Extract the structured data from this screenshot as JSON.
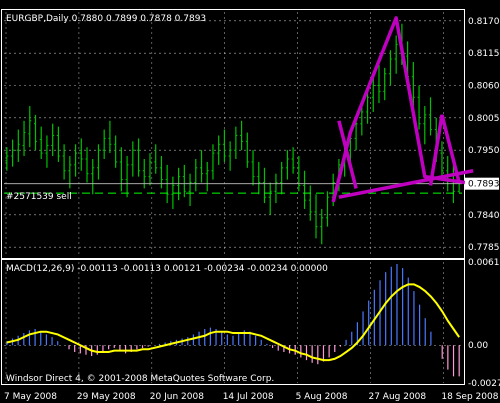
{
  "header": {
    "symbol_line": "EURGBP,Daily  0.7880 0.7899 0.7878 0.7893",
    "order_label": "#2571539 sell"
  },
  "footer": {
    "copyright": "Windsor Direct 4, © 2001-2008 MetaQuotes Software Corp."
  },
  "macd": {
    "title": "MACD(12,26,9) -0.00113 -0.00113 0.00121 -0.00234 -0.00234 0.00000"
  },
  "price_axis": {
    "labels": [
      "0.8170",
      "0.8115",
      "0.8060",
      "0.8005",
      "0.7950",
      "0.7893",
      "0.7840",
      "0.7785"
    ],
    "current": "0.7893"
  },
  "macd_axis": {
    "labels": [
      "0.00615",
      "0.00",
      "-0.00279"
    ]
  },
  "time_axis": {
    "labels": [
      "7 May 2008",
      "29 May 2008",
      "20 Jun 2008",
      "14 Jul 2008",
      "5 Aug 2008",
      "27 Aug 2008",
      "18 Sep 2008"
    ]
  },
  "colors": {
    "background": "#000000",
    "candles": "#00c000",
    "grid": "#ffffff",
    "pattern": "#c000c0",
    "signal": "#ffff00",
    "hist_pos": "#4a78ff",
    "hist_neg": "#ff9ad8",
    "order_line": "#00ff00",
    "current_line": "#c0c0c0"
  },
  "chart_data": [
    {
      "type": "candlestick",
      "title": "EURGBP,Daily",
      "ylim": [
        0.777,
        0.8185
      ],
      "x_labels": [
        "7 May 2008",
        "29 May 2008",
        "20 Jun 2008",
        "14 Jul 2008",
        "5 Aug 2008",
        "27 Aug 2008",
        "18 Sep 2008"
      ],
      "ohlc": [
        [
          0.7932,
          0.7955,
          0.7915,
          0.794
        ],
        [
          0.794,
          0.7968,
          0.7922,
          0.795
        ],
        [
          0.795,
          0.7985,
          0.793,
          0.796
        ],
        [
          0.7958,
          0.8,
          0.794,
          0.798
        ],
        [
          0.7978,
          0.8025,
          0.7955,
          0.8
        ],
        [
          0.7995,
          0.801,
          0.795,
          0.7965
        ],
        [
          0.7968,
          0.799,
          0.7935,
          0.7945
        ],
        [
          0.7945,
          0.7975,
          0.792,
          0.7958
        ],
        [
          0.7958,
          0.7995,
          0.794,
          0.7975
        ],
        [
          0.7975,
          0.799,
          0.793,
          0.794
        ],
        [
          0.794,
          0.796,
          0.79,
          0.7915
        ],
        [
          0.7915,
          0.794,
          0.7885,
          0.7925
        ],
        [
          0.7925,
          0.796,
          0.7905,
          0.7945
        ],
        [
          0.7945,
          0.797,
          0.7915,
          0.7935
        ],
        [
          0.7935,
          0.7955,
          0.7895,
          0.791
        ],
        [
          0.791,
          0.7935,
          0.7875,
          0.792
        ],
        [
          0.792,
          0.796,
          0.79,
          0.795
        ],
        [
          0.795,
          0.7985,
          0.7935,
          0.797
        ],
        [
          0.797,
          0.8,
          0.7945,
          0.796
        ],
        [
          0.796,
          0.7975,
          0.792,
          0.793
        ],
        [
          0.793,
          0.7955,
          0.788,
          0.79
        ],
        [
          0.79,
          0.794,
          0.787,
          0.7925
        ],
        [
          0.7925,
          0.7965,
          0.7905,
          0.795
        ],
        [
          0.795,
          0.797,
          0.7905,
          0.7915
        ],
        [
          0.7915,
          0.7935,
          0.7885,
          0.7905
        ],
        [
          0.7905,
          0.7945,
          0.789,
          0.793
        ],
        [
          0.793,
          0.796,
          0.791,
          0.792
        ],
        [
          0.792,
          0.794,
          0.7885,
          0.79
        ],
        [
          0.79,
          0.7925,
          0.786,
          0.7875
        ],
        [
          0.7875,
          0.7905,
          0.785,
          0.789
        ],
        [
          0.789,
          0.792,
          0.7865,
          0.7905
        ],
        [
          0.7905,
          0.7925,
          0.787,
          0.788
        ],
        [
          0.788,
          0.791,
          0.7855,
          0.7895
        ],
        [
          0.7895,
          0.7935,
          0.788,
          0.792
        ],
        [
          0.792,
          0.795,
          0.7895,
          0.791
        ],
        [
          0.791,
          0.793,
          0.788,
          0.7915
        ],
        [
          0.7915,
          0.796,
          0.79,
          0.7945
        ],
        [
          0.7945,
          0.7975,
          0.7925,
          0.796
        ],
        [
          0.796,
          0.7985,
          0.793,
          0.794
        ],
        [
          0.794,
          0.7965,
          0.7915,
          0.795
        ],
        [
          0.795,
          0.799,
          0.7935,
          0.7975
        ],
        [
          0.7975,
          0.8,
          0.795,
          0.7965
        ],
        [
          0.7965,
          0.798,
          0.792,
          0.793
        ],
        [
          0.793,
          0.795,
          0.789,
          0.7905
        ],
        [
          0.7905,
          0.793,
          0.7875,
          0.7895
        ],
        [
          0.7895,
          0.792,
          0.786,
          0.787
        ],
        [
          0.787,
          0.7895,
          0.784,
          0.788
        ],
        [
          0.788,
          0.791,
          0.786,
          0.7895
        ],
        [
          0.7895,
          0.793,
          0.7875,
          0.792
        ],
        [
          0.792,
          0.795,
          0.79,
          0.7935
        ],
        [
          0.7935,
          0.7955,
          0.791,
          0.792
        ],
        [
          0.792,
          0.794,
          0.788,
          0.789
        ],
        [
          0.789,
          0.7915,
          0.785,
          0.7865
        ],
        [
          0.7865,
          0.789,
          0.783,
          0.7845
        ],
        [
          0.7845,
          0.7875,
          0.78,
          0.782
        ],
        [
          0.782,
          0.785,
          0.779,
          0.7835
        ],
        [
          0.7835,
          0.788,
          0.782,
          0.787
        ],
        [
          0.787,
          0.791,
          0.7855,
          0.7895
        ],
        [
          0.7895,
          0.7935,
          0.788,
          0.7925
        ],
        [
          0.7925,
          0.7965,
          0.7905,
          0.795
        ],
        [
          0.795,
          0.7985,
          0.793,
          0.797
        ],
        [
          0.797,
          0.801,
          0.795,
          0.7995
        ],
        [
          0.7995,
          0.803,
          0.7975,
          0.8015
        ],
        [
          0.8015,
          0.8055,
          0.7995,
          0.804
        ],
        [
          0.804,
          0.8075,
          0.8015,
          0.806
        ],
        [
          0.806,
          0.8095,
          0.803,
          0.805
        ],
        [
          0.805,
          0.809,
          0.8035,
          0.808
        ],
        [
          0.808,
          0.812,
          0.806,
          0.8105
        ],
        [
          0.8105,
          0.8145,
          0.808,
          0.813
        ],
        [
          0.813,
          0.8165,
          0.8095,
          0.811
        ],
        [
          0.811,
          0.8135,
          0.806,
          0.8075
        ],
        [
          0.8075,
          0.81,
          0.8025,
          0.804
        ],
        [
          0.804,
          0.806,
          0.7985,
          0.7995
        ],
        [
          0.7995,
          0.8025,
          0.796,
          0.801
        ],
        [
          0.801,
          0.804,
          0.7975,
          0.7985
        ],
        [
          0.7985,
          0.8005,
          0.793,
          0.7945
        ],
        [
          0.7945,
          0.7965,
          0.79,
          0.7915
        ],
        [
          0.7915,
          0.794,
          0.788,
          0.79
        ],
        [
          0.79,
          0.7925,
          0.786,
          0.788
        ],
        [
          0.788,
          0.79,
          0.7878,
          0.7893
        ]
      ],
      "order_level": 0.7877,
      "current_price": 0.7893,
      "pattern_polyline": [
        [
          0.7877,
          0.7877
        ],
        [
          0.7995,
          0.7995
        ]
      ]
    },
    {
      "type": "macd",
      "title": "MACD(12,26,9)",
      "ylim": [
        -0.00279,
        0.00615
      ],
      "histogram": [
        0.0003,
        0.0005,
        0.0007,
        0.0009,
        0.0011,
        0.0012,
        0.001,
        0.0008,
        0.0006,
        0.0003,
        0.0,
        -0.0003,
        -0.0005,
        -0.0006,
        -0.0007,
        -0.0008,
        -0.0007,
        -0.0005,
        -0.0003,
        -0.0002,
        -0.0004,
        -0.0006,
        -0.0005,
        -0.0003,
        -0.0002,
        -0.0001,
        0.0,
        0.0001,
        0.0002,
        0.0003,
        0.0004,
        0.0005,
        0.0006,
        0.0008,
        0.001,
        0.0012,
        0.0013,
        0.0012,
        0.001,
        0.0008,
        0.0007,
        0.0009,
        0.0011,
        0.001,
        0.0007,
        0.0004,
        0.0001,
        -0.0002,
        -0.0004,
        -0.0005,
        -0.0006,
        -0.0007,
        -0.0009,
        -0.0011,
        -0.0013,
        -0.0014,
        -0.0012,
        -0.0009,
        -0.0005,
        -0.0001,
        0.0004,
        0.001,
        0.0017,
        0.0025,
        0.0033,
        0.0041,
        0.0048,
        0.0054,
        0.0058,
        0.006,
        0.0057,
        0.005,
        0.004,
        0.003,
        0.002,
        0.001,
        0.0,
        -0.001,
        -0.0018,
        -0.0023,
        -0.0023
      ],
      "signal": [
        0.0002,
        0.0003,
        0.0004,
        0.0006,
        0.0008,
        0.0009,
        0.001,
        0.001,
        0.0009,
        0.0008,
        0.0006,
        0.0004,
        0.0002,
        0.0,
        -0.0002,
        -0.0004,
        -0.0005,
        -0.0005,
        -0.0005,
        -0.0004,
        -0.0004,
        -0.0004,
        -0.0004,
        -0.0004,
        -0.0003,
        -0.0003,
        -0.0002,
        -0.0001,
        0.0,
        0.0001,
        0.0002,
        0.0003,
        0.0004,
        0.0005,
        0.0006,
        0.0007,
        0.0009,
        0.001,
        0.001,
        0.001,
        0.0009,
        0.0009,
        0.0009,
        0.0009,
        0.0008,
        0.0007,
        0.0005,
        0.0003,
        0.0001,
        -0.0001,
        -0.0003,
        -0.0004,
        -0.0006,
        -0.0007,
        -0.0009,
        -0.001,
        -0.0011,
        -0.0011,
        -0.001,
        -0.0008,
        -0.0005,
        -0.0002,
        0.0002,
        0.0007,
        0.0013,
        0.0019,
        0.0025,
        0.0031,
        0.0036,
        0.004,
        0.0043,
        0.0045,
        0.0045,
        0.0043,
        0.004,
        0.0036,
        0.0031,
        0.0025,
        0.0018,
        0.0012,
        0.0006
      ]
    }
  ]
}
